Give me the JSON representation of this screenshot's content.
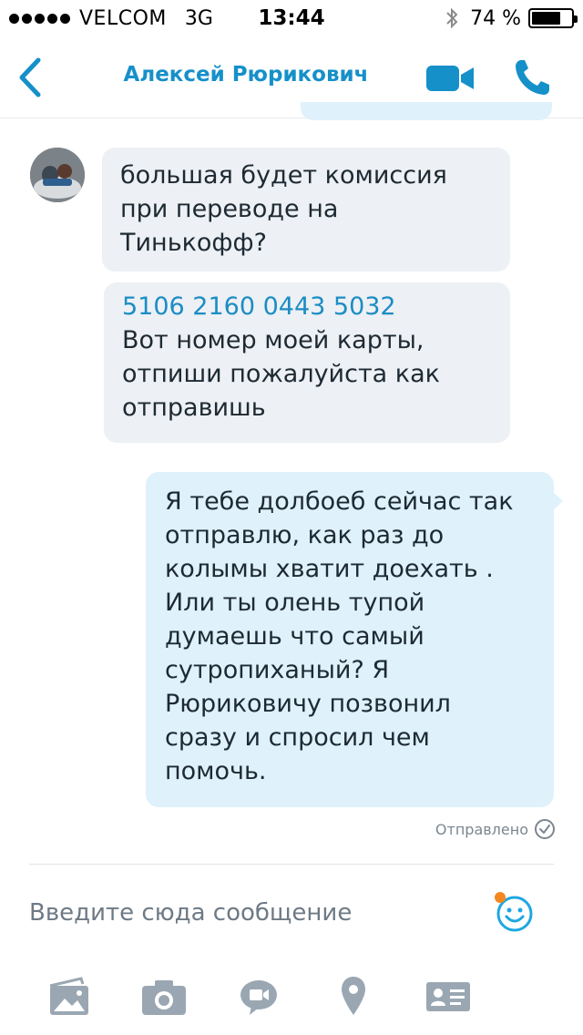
{
  "status_bar": {
    "carrier": "VELCOM",
    "network": "3G",
    "time": "13:44",
    "battery": "74 %",
    "battery_level": 0.74,
    "icons": [
      "signal-dots",
      "bluetooth-icon",
      "battery-icon"
    ]
  },
  "nav": {
    "title": "Алексей Рюрикович",
    "icons": [
      "back-chevron-icon",
      "video-call-icon",
      "phone-icon"
    ],
    "accent_color": "#1590c9"
  },
  "messages": [
    {
      "direction": "incoming",
      "lines": [
        "большая будет комиссия",
        "при переводе на",
        "Тинькофф?"
      ]
    },
    {
      "direction": "incoming",
      "card_number": "5106 2160 0443 5032",
      "lines": [
        "Вот номер моей карты,",
        "отпиши пожалуйста как",
        "отправишь"
      ]
    },
    {
      "direction": "outgoing",
      "lines": [
        "Я тебе долбоеб сейчас так",
        "отправлю, как раз до",
        "колымы хватит доехать .",
        "Или ты олень тупой",
        "думаешь что самый",
        "сутропиханый? Я",
        "Рюриковичу позвонил",
        "сразу и спросил чем",
        "помочь."
      ]
    }
  ],
  "sent_status": "Отправлено",
  "composer": {
    "placeholder": "Введите сюда сообщение"
  },
  "toolbar": {
    "icons": [
      "gallery-icon",
      "camera-icon",
      "video-message-icon",
      "location-icon",
      "contact-card-icon"
    ]
  },
  "colors": {
    "incoming_bubble": "#edf0f4",
    "outgoing_bubble": "#dff1fb",
    "icon_gray": "#9aa7b2",
    "card_link": "#1b8dc4",
    "emoji_notification": "#f5871f"
  }
}
